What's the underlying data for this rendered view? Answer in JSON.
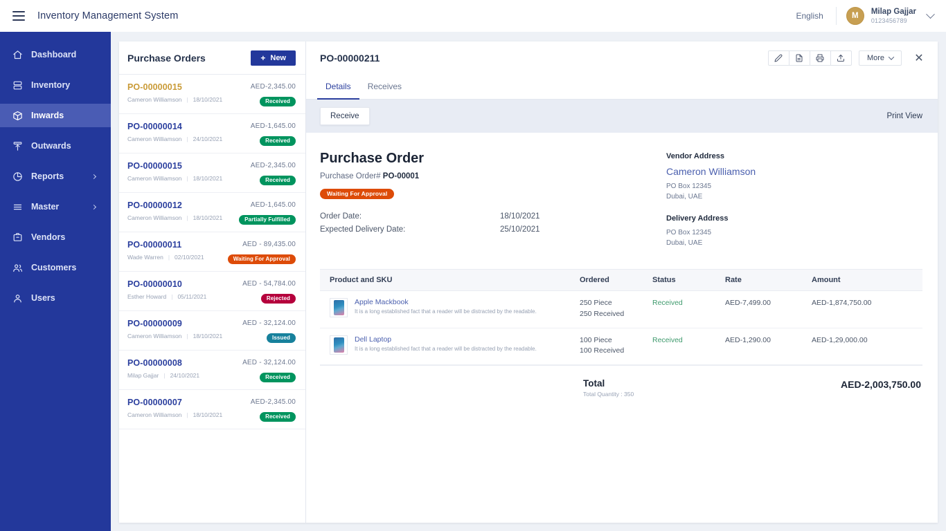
{
  "topbar": {
    "app_title": "Inventory Management System",
    "language": "English",
    "user_name": "Milap Gajjar",
    "user_phone": "0123456789",
    "avatar_initial": "M"
  },
  "sidebar": {
    "items": [
      {
        "label": "Dashboard",
        "icon": "home-icon",
        "active": false,
        "chevron": false
      },
      {
        "label": "Inventory",
        "icon": "boxes-icon",
        "active": false,
        "chevron": false
      },
      {
        "label": "Inwards",
        "icon": "inwards-icon",
        "active": true,
        "chevron": false
      },
      {
        "label": "Outwards",
        "icon": "outwards-icon",
        "active": false,
        "chevron": false
      },
      {
        "label": "Reports",
        "icon": "pie-chart-icon",
        "active": false,
        "chevron": true
      },
      {
        "label": "Master",
        "icon": "list-icon",
        "active": false,
        "chevron": true
      },
      {
        "label": "Vendors",
        "icon": "briefcase-icon",
        "active": false,
        "chevron": false
      },
      {
        "label": "Customers",
        "icon": "users-icon",
        "active": false,
        "chevron": false
      },
      {
        "label": "Users",
        "icon": "user-icon",
        "active": false,
        "chevron": false
      }
    ]
  },
  "list_panel": {
    "title": "Purchase Orders",
    "new_label": "New",
    "items": [
      {
        "code": "PO-00000015",
        "vendor": "Cameron Williamson",
        "date": "18/10/2021",
        "amount": "AED-2,345.00",
        "status": "Received",
        "status_color": "#00945e",
        "selected": true
      },
      {
        "code": "PO-00000014",
        "vendor": "Cameron Williamson",
        "date": "24/10/2021",
        "amount": "AED-1,645.00",
        "status": "Received",
        "status_color": "#00945e",
        "selected": false
      },
      {
        "code": "PO-00000015",
        "vendor": "Cameron Williamson",
        "date": "18/10/2021",
        "amount": "AED-2,345.00",
        "status": "Received",
        "status_color": "#00945e",
        "selected": false
      },
      {
        "code": "PO-00000012",
        "vendor": "Cameron Williamson",
        "date": "18/10/2021",
        "amount": "AED-1,645.00",
        "status": "Partially Fulfilled",
        "status_color": "#00945e",
        "selected": false
      },
      {
        "code": "PO-00000011",
        "vendor": "Wade Warren",
        "date": "02/10/2021",
        "amount": "AED - 89,435.00",
        "status": "Waiting For Approval",
        "status_color": "#dd4b08",
        "selected": false
      },
      {
        "code": "PO-00000010",
        "vendor": "Esther Howard",
        "date": "05/11/2021",
        "amount": "AED - 54,784.00",
        "status": "Rejected",
        "status_color": "#b5003c",
        "selected": false
      },
      {
        "code": "PO-00000009",
        "vendor": "Cameron Williamson",
        "date": "18/10/2021",
        "amount": "AED - 32,124.00",
        "status": "Issued",
        "status_color": "#17819c",
        "selected": false
      },
      {
        "code": "PO-00000008",
        "vendor": "Milap Gajjar",
        "date": "24/10/2021",
        "amount": "AED - 32,124.00",
        "status": "Received",
        "status_color": "#00945e",
        "selected": false
      },
      {
        "code": "PO-00000007",
        "vendor": "Cameron Williamson",
        "date": "18/10/2021",
        "amount": "AED-2,345.00",
        "status": "Received",
        "status_color": "#00945e",
        "selected": false
      }
    ]
  },
  "detail": {
    "title": "PO-00000211",
    "actions": {
      "edit": "edit-icon",
      "document": "document-icon",
      "print": "printer-icon",
      "share": "upload-icon",
      "more_label": "More",
      "close": "close-icon"
    },
    "tabs": [
      {
        "label": "Details",
        "active": true
      },
      {
        "label": "Receives",
        "active": false
      }
    ],
    "subbar": {
      "receive_label": "Receive",
      "print_view_label": "Print View"
    },
    "document": {
      "heading": "Purchase Order",
      "po_label": "Purchase Order#",
      "po_number": "PO-00001",
      "status_badge": "Waiting For Approval",
      "status_badge_color": "#dd4b08",
      "order_date_label": "Order Date:",
      "order_date": "18/10/2021",
      "expected_label": "Expected Delivery Date:",
      "expected_date": "25/10/2021",
      "vendor_address_heading": "Vendor Address",
      "vendor_name": "Cameron Williamson",
      "vendor_line1": "PO Box 12345",
      "vendor_line2": "Dubai, UAE",
      "delivery_address_heading": "Delivery Address",
      "delivery_line1": "PO Box 12345",
      "delivery_line2": "Dubai, UAE"
    },
    "table": {
      "columns": [
        "Product and SKU",
        "Ordered",
        "Status",
        "Rate",
        "Amount"
      ],
      "rows": [
        {
          "product": "Apple Mackbook",
          "description": "It is a long established fact that a reader will be distracted by the readable.",
          "ordered_qty": "250 Piece",
          "ordered_received": "250 Received",
          "status": "Received",
          "rate": "AED-7,499.00",
          "amount": "AED-1,874,750.00"
        },
        {
          "product": "Dell Laptop",
          "description": "It is a long established fact that a reader will be distracted by the readable.",
          "ordered_qty": "100 Piece",
          "ordered_received": "100 Received",
          "status": "Received",
          "rate": "AED-1,290.00",
          "amount": "AED-1,29,000.00"
        }
      ],
      "total_label": "Total",
      "total_quantity": "Total Quantity : 350",
      "total_value": "AED-2,003,750.00"
    }
  }
}
